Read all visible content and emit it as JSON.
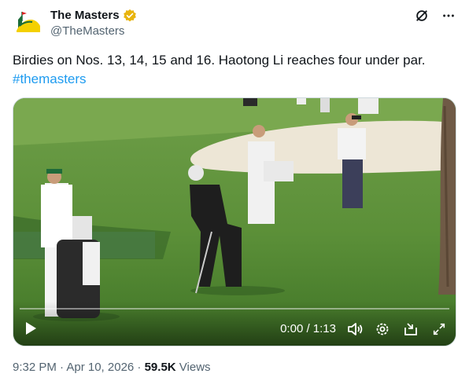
{
  "account": {
    "display_name": "The Masters",
    "handle": "@TheMasters",
    "avatar_icon": "masters-logo-icon",
    "verified_icon": "verified-badge-icon",
    "verified_color": "#e8b40e"
  },
  "header_actions": [
    "grok-icon",
    "more-icon"
  ],
  "tweet": {
    "text": "Birdies on Nos. 13, 14, 15 and 16. Haotong Li reaches four under par.",
    "hashtag": "#themasters",
    "hashtag_color": "#1d9bf0"
  },
  "video": {
    "time_display": "0:00 / 1:13",
    "progress": 0,
    "controls": [
      "play-icon",
      "volume-icon",
      "settings-icon",
      "popout-icon",
      "fullscreen-icon"
    ]
  },
  "meta": {
    "timestamp": "9:32 PM · Apr 10, 2026 · ",
    "views_count": "59.5K",
    "views_label": " Views"
  }
}
